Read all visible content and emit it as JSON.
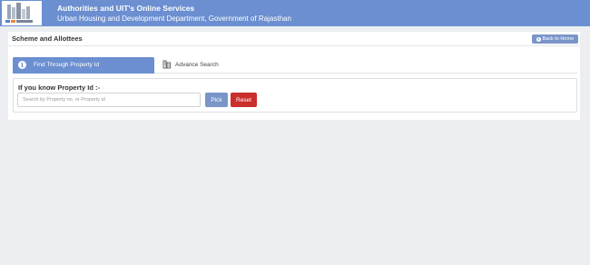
{
  "header": {
    "title": "Authorities and UIT's Online Services",
    "subtitle": "Urban Housing and Development Department, Government of Rajasthan",
    "logo_icon": "building-logo-icon",
    "background_color": "#6b8fd0"
  },
  "page": {
    "title": "Scheme and Allottees",
    "back_button_label": "Back to Home",
    "back_icon": "arrow-circle-left-icon"
  },
  "tabs": [
    {
      "label": "Find Through Property Id",
      "icon": "info-icon",
      "active": true
    },
    {
      "label": "Advance Search",
      "icon": "building-icon",
      "active": false
    }
  ],
  "search": {
    "heading": "If you know Property Id :-",
    "placeholder": "Search by Property no, or Property id",
    "value": "",
    "pick_label": "Pick",
    "reset_label": "Reset"
  },
  "colors": {
    "accent": "#6b8fd0",
    "button_primary": "#7a95c8",
    "button_danger": "#c9302c",
    "background": "#eceef1"
  }
}
